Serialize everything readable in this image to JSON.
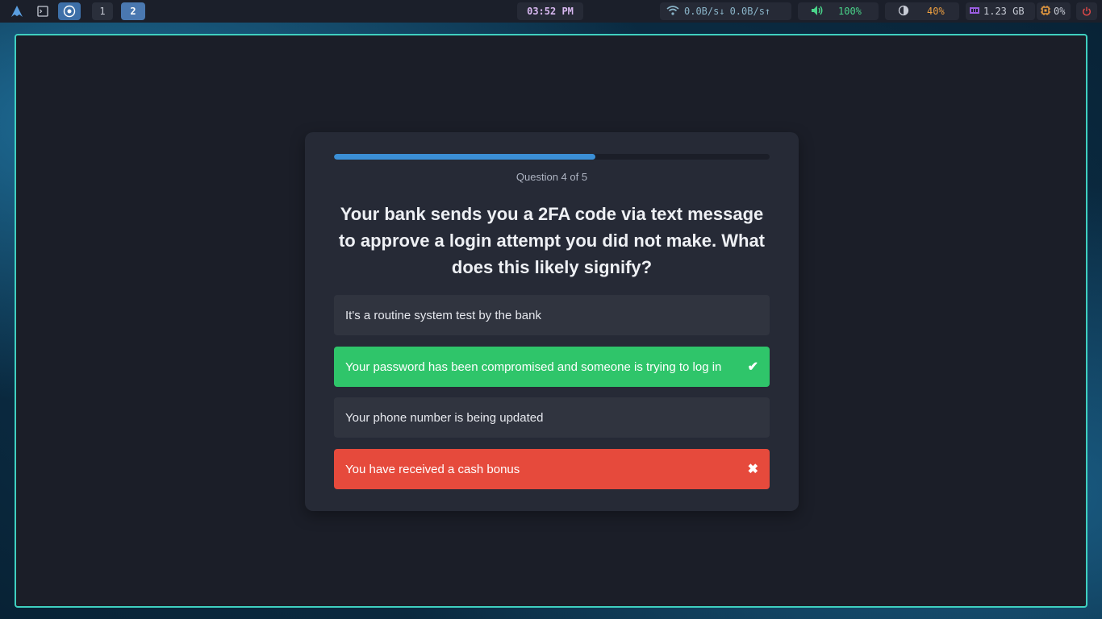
{
  "topbar": {
    "workspaces": [
      "1",
      "2"
    ],
    "active_workspace": "2",
    "clock": "03:52 PM",
    "network": {
      "icon": "wifi-icon",
      "down": "0.0B/s↓",
      "up": "0.0B/s↑"
    },
    "volume": {
      "icon": "speaker-icon",
      "value": "100%"
    },
    "brightness": {
      "icon": "brightness-icon",
      "value": "40%"
    },
    "memory": {
      "icon": "memory-icon",
      "value": "1.23 GB"
    },
    "cpu": {
      "icon": "cpu-icon",
      "value": "0%"
    },
    "power": {
      "icon": "power-icon"
    }
  },
  "quiz": {
    "progress_fraction": 0.6,
    "counter": "Question 4 of 5",
    "question": "Your bank sends you a 2FA code via text message to approve a login attempt you did not make. What does this likely signify?",
    "options": [
      {
        "label": "It's a routine system test by the bank",
        "state": "neutral",
        "mark": ""
      },
      {
        "label": "Your password has been compromised and someone is trying to log in",
        "state": "correct",
        "mark": "✔"
      },
      {
        "label": "Your phone number is being updated",
        "state": "neutral",
        "mark": ""
      },
      {
        "label": "You have received a cash bonus",
        "state": "incorrect",
        "mark": "✖"
      }
    ]
  },
  "colors": {
    "correct": "#2fc56a",
    "incorrect": "#e64a3c",
    "progress": "#3b8fd6",
    "window_border": "#3fd0c0"
  }
}
